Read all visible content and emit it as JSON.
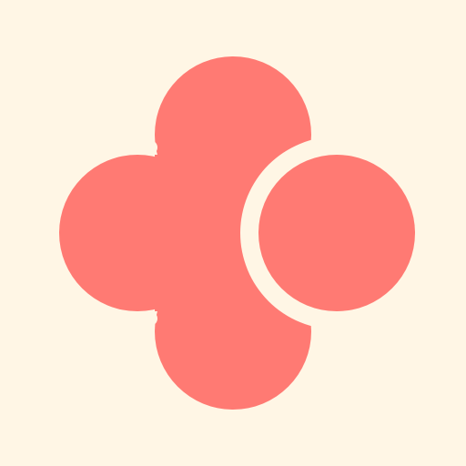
{
  "logo": {
    "icon": "four-lobed-flower-logo-icon",
    "colors": {
      "background": "#FFF6E5",
      "shape": "#FF7A73"
    }
  }
}
